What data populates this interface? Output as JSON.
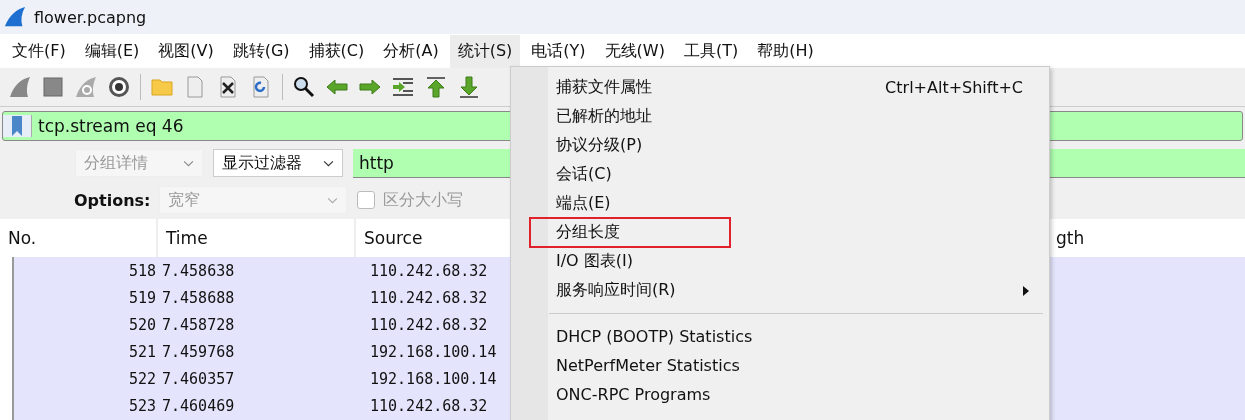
{
  "window": {
    "title": "flower.pcapng"
  },
  "menubar": [
    {
      "label": "文件(F)",
      "selected": false
    },
    {
      "label": "编辑(E)",
      "selected": false
    },
    {
      "label": "视图(V)",
      "selected": false
    },
    {
      "label": "跳转(G)",
      "selected": false
    },
    {
      "label": "捕获(C)",
      "selected": false
    },
    {
      "label": "分析(A)",
      "selected": false
    },
    {
      "label": "统计(S)",
      "selected": true
    },
    {
      "label": "电话(Y)",
      "selected": false
    },
    {
      "label": "无线(W)",
      "selected": false
    },
    {
      "label": "工具(T)",
      "selected": false
    },
    {
      "label": "帮助(H)",
      "selected": false
    }
  ],
  "display_filter": {
    "value": "tcp.stream eq 46"
  },
  "find_bar": {
    "scope": "分组详情",
    "scope_disabled": true,
    "type": "显示过滤器",
    "value": "http",
    "options_label": "Options:",
    "charset": "宽窄",
    "case_sensitive": {
      "label": "区分大小写",
      "checked": false
    }
  },
  "table": {
    "columns": [
      "No.",
      "Time",
      "Source",
      "gth"
    ],
    "rows": [
      [
        "518",
        "7.458638",
        "110.242.68.32"
      ],
      [
        "519",
        "7.458688",
        "110.242.68.32"
      ],
      [
        "520",
        "7.458728",
        "110.242.68.32"
      ],
      [
        "521",
        "7.459768",
        "192.168.100.14"
      ],
      [
        "522",
        "7.460357",
        "192.168.100.14"
      ],
      [
        "523",
        "7.460469",
        "110.242.68.32"
      ]
    ]
  },
  "statistics_menu": [
    {
      "kind": "item",
      "label": "捕获文件属性",
      "shortcut": "Ctrl+Alt+Shift+C",
      "annotated": false,
      "submenu": false
    },
    {
      "kind": "item",
      "label": "已解析的地址",
      "annotated": false,
      "submenu": false
    },
    {
      "kind": "item",
      "label": "协议分级(P)",
      "annotated": false,
      "submenu": false
    },
    {
      "kind": "item",
      "label": "会话(C)",
      "annotated": false,
      "submenu": false
    },
    {
      "kind": "item",
      "label": "端点(E)",
      "annotated": false,
      "submenu": false
    },
    {
      "kind": "item",
      "label": "分组长度",
      "annotated": true,
      "submenu": false
    },
    {
      "kind": "item",
      "label": "I/O 图表(I)",
      "annotated": false,
      "submenu": false
    },
    {
      "kind": "item",
      "label": "服务响应时间(R)",
      "annotated": false,
      "submenu": true
    },
    {
      "kind": "separator"
    },
    {
      "kind": "item",
      "label": "DHCP (BOOTP) Statistics",
      "annotated": false,
      "submenu": false
    },
    {
      "kind": "item",
      "label": "NetPerfMeter Statistics",
      "annotated": false,
      "submenu": false
    },
    {
      "kind": "item",
      "label": "ONC-RPC Programs",
      "annotated": false,
      "submenu": false
    }
  ]
}
